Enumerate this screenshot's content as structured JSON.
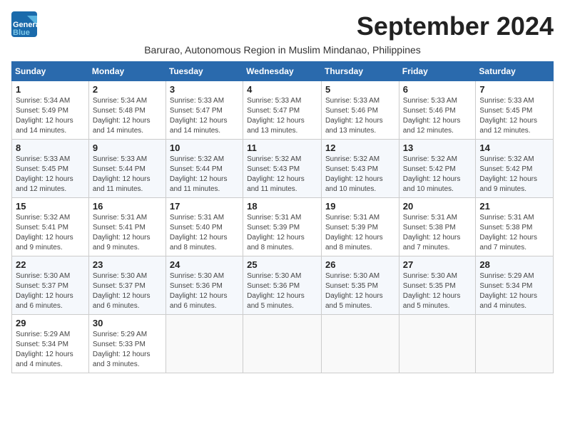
{
  "header": {
    "logo_general": "General",
    "logo_blue": "Blue",
    "month_title": "September 2024",
    "subtitle": "Barurao, Autonomous Region in Muslim Mindanao, Philippines"
  },
  "days_of_week": [
    "Sunday",
    "Monday",
    "Tuesday",
    "Wednesday",
    "Thursday",
    "Friday",
    "Saturday"
  ],
  "weeks": [
    [
      {
        "day": "1",
        "sunrise": "Sunrise: 5:34 AM",
        "sunset": "Sunset: 5:49 PM",
        "daylight": "Daylight: 12 hours and 14 minutes."
      },
      {
        "day": "2",
        "sunrise": "Sunrise: 5:34 AM",
        "sunset": "Sunset: 5:48 PM",
        "daylight": "Daylight: 12 hours and 14 minutes."
      },
      {
        "day": "3",
        "sunrise": "Sunrise: 5:33 AM",
        "sunset": "Sunset: 5:47 PM",
        "daylight": "Daylight: 12 hours and 14 minutes."
      },
      {
        "day": "4",
        "sunrise": "Sunrise: 5:33 AM",
        "sunset": "Sunset: 5:47 PM",
        "daylight": "Daylight: 12 hours and 13 minutes."
      },
      {
        "day": "5",
        "sunrise": "Sunrise: 5:33 AM",
        "sunset": "Sunset: 5:46 PM",
        "daylight": "Daylight: 12 hours and 13 minutes."
      },
      {
        "day": "6",
        "sunrise": "Sunrise: 5:33 AM",
        "sunset": "Sunset: 5:46 PM",
        "daylight": "Daylight: 12 hours and 12 minutes."
      },
      {
        "day": "7",
        "sunrise": "Sunrise: 5:33 AM",
        "sunset": "Sunset: 5:45 PM",
        "daylight": "Daylight: 12 hours and 12 minutes."
      }
    ],
    [
      {
        "day": "8",
        "sunrise": "Sunrise: 5:33 AM",
        "sunset": "Sunset: 5:45 PM",
        "daylight": "Daylight: 12 hours and 12 minutes."
      },
      {
        "day": "9",
        "sunrise": "Sunrise: 5:33 AM",
        "sunset": "Sunset: 5:44 PM",
        "daylight": "Daylight: 12 hours and 11 minutes."
      },
      {
        "day": "10",
        "sunrise": "Sunrise: 5:32 AM",
        "sunset": "Sunset: 5:44 PM",
        "daylight": "Daylight: 12 hours and 11 minutes."
      },
      {
        "day": "11",
        "sunrise": "Sunrise: 5:32 AM",
        "sunset": "Sunset: 5:43 PM",
        "daylight": "Daylight: 12 hours and 11 minutes."
      },
      {
        "day": "12",
        "sunrise": "Sunrise: 5:32 AM",
        "sunset": "Sunset: 5:43 PM",
        "daylight": "Daylight: 12 hours and 10 minutes."
      },
      {
        "day": "13",
        "sunrise": "Sunrise: 5:32 AM",
        "sunset": "Sunset: 5:42 PM",
        "daylight": "Daylight: 12 hours and 10 minutes."
      },
      {
        "day": "14",
        "sunrise": "Sunrise: 5:32 AM",
        "sunset": "Sunset: 5:42 PM",
        "daylight": "Daylight: 12 hours and 9 minutes."
      }
    ],
    [
      {
        "day": "15",
        "sunrise": "Sunrise: 5:32 AM",
        "sunset": "Sunset: 5:41 PM",
        "daylight": "Daylight: 12 hours and 9 minutes."
      },
      {
        "day": "16",
        "sunrise": "Sunrise: 5:31 AM",
        "sunset": "Sunset: 5:41 PM",
        "daylight": "Daylight: 12 hours and 9 minutes."
      },
      {
        "day": "17",
        "sunrise": "Sunrise: 5:31 AM",
        "sunset": "Sunset: 5:40 PM",
        "daylight": "Daylight: 12 hours and 8 minutes."
      },
      {
        "day": "18",
        "sunrise": "Sunrise: 5:31 AM",
        "sunset": "Sunset: 5:39 PM",
        "daylight": "Daylight: 12 hours and 8 minutes."
      },
      {
        "day": "19",
        "sunrise": "Sunrise: 5:31 AM",
        "sunset": "Sunset: 5:39 PM",
        "daylight": "Daylight: 12 hours and 8 minutes."
      },
      {
        "day": "20",
        "sunrise": "Sunrise: 5:31 AM",
        "sunset": "Sunset: 5:38 PM",
        "daylight": "Daylight: 12 hours and 7 minutes."
      },
      {
        "day": "21",
        "sunrise": "Sunrise: 5:31 AM",
        "sunset": "Sunset: 5:38 PM",
        "daylight": "Daylight: 12 hours and 7 minutes."
      }
    ],
    [
      {
        "day": "22",
        "sunrise": "Sunrise: 5:30 AM",
        "sunset": "Sunset: 5:37 PM",
        "daylight": "Daylight: 12 hours and 6 minutes."
      },
      {
        "day": "23",
        "sunrise": "Sunrise: 5:30 AM",
        "sunset": "Sunset: 5:37 PM",
        "daylight": "Daylight: 12 hours and 6 minutes."
      },
      {
        "day": "24",
        "sunrise": "Sunrise: 5:30 AM",
        "sunset": "Sunset: 5:36 PM",
        "daylight": "Daylight: 12 hours and 6 minutes."
      },
      {
        "day": "25",
        "sunrise": "Sunrise: 5:30 AM",
        "sunset": "Sunset: 5:36 PM",
        "daylight": "Daylight: 12 hours and 5 minutes."
      },
      {
        "day": "26",
        "sunrise": "Sunrise: 5:30 AM",
        "sunset": "Sunset: 5:35 PM",
        "daylight": "Daylight: 12 hours and 5 minutes."
      },
      {
        "day": "27",
        "sunrise": "Sunrise: 5:30 AM",
        "sunset": "Sunset: 5:35 PM",
        "daylight": "Daylight: 12 hours and 5 minutes."
      },
      {
        "day": "28",
        "sunrise": "Sunrise: 5:29 AM",
        "sunset": "Sunset: 5:34 PM",
        "daylight": "Daylight: 12 hours and 4 minutes."
      }
    ],
    [
      {
        "day": "29",
        "sunrise": "Sunrise: 5:29 AM",
        "sunset": "Sunset: 5:34 PM",
        "daylight": "Daylight: 12 hours and 4 minutes."
      },
      {
        "day": "30",
        "sunrise": "Sunrise: 5:29 AM",
        "sunset": "Sunset: 5:33 PM",
        "daylight": "Daylight: 12 hours and 3 minutes."
      },
      null,
      null,
      null,
      null,
      null
    ]
  ]
}
